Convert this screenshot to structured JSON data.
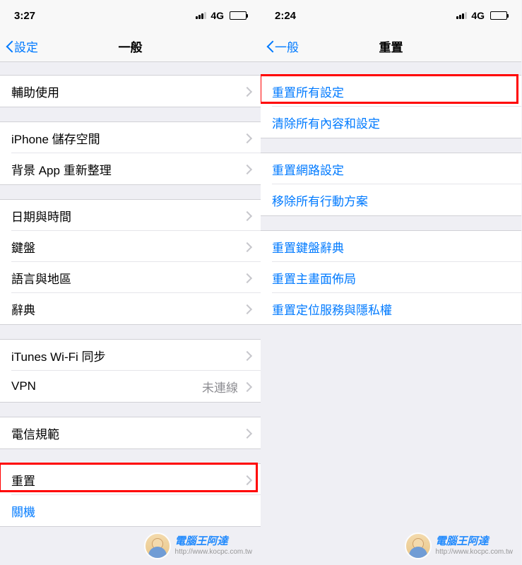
{
  "left": {
    "status": {
      "time": "3:27",
      "network": "4G"
    },
    "nav": {
      "back": "設定",
      "title": "一般"
    },
    "sections": [
      [
        {
          "label": "輔助使用",
          "chevron": true
        }
      ],
      [
        {
          "label": "iPhone 儲存空間",
          "chevron": true
        },
        {
          "label": "背景 App 重新整理",
          "chevron": true
        }
      ],
      [
        {
          "label": "日期與時間",
          "chevron": true
        },
        {
          "label": "鍵盤",
          "chevron": true
        },
        {
          "label": "語言與地區",
          "chevron": true
        },
        {
          "label": "辭典",
          "chevron": true
        }
      ],
      [
        {
          "label": "iTunes Wi-Fi 同步",
          "chevron": true
        },
        {
          "label": "VPN",
          "value": "未連線",
          "chevron": true
        }
      ],
      [
        {
          "label": "電信規範",
          "chevron": true
        }
      ],
      [
        {
          "label": "重置",
          "chevron": true,
          "highlight": true
        },
        {
          "label": "關機",
          "link": true
        }
      ]
    ]
  },
  "right": {
    "status": {
      "time": "2:24",
      "network": "4G"
    },
    "nav": {
      "back": "一般",
      "title": "重置"
    },
    "sections": [
      [
        {
          "label": "重置所有設定",
          "link": true,
          "highlight": true
        },
        {
          "label": "清除所有內容和設定",
          "link": true
        }
      ],
      [
        {
          "label": "重置網路設定",
          "link": true
        },
        {
          "label": "移除所有行動方案",
          "link": true
        }
      ],
      [
        {
          "label": "重置鍵盤辭典",
          "link": true
        },
        {
          "label": "重置主畫面佈局",
          "link": true
        },
        {
          "label": "重置定位服務與隱私權",
          "link": true
        }
      ]
    ]
  },
  "watermark": {
    "title": "電腦王阿達",
    "url": "http://www.kocpc.com.tw"
  }
}
